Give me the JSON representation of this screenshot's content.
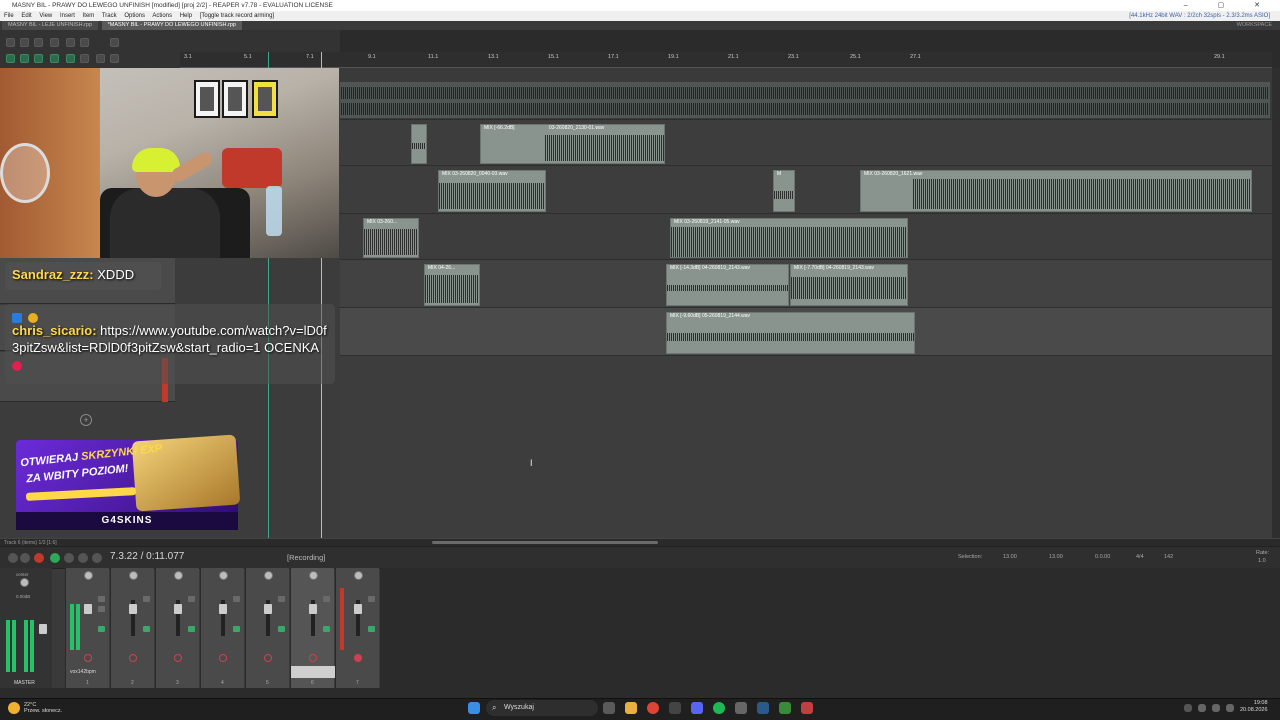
{
  "window": {
    "title": "MASNY BIL - PRAWY DO LEWEGO UNFINISH [modified] [proj 2/2] - REAPER v7.78 - EVALUATION LICENSE",
    "controls": "– ▢ ✕"
  },
  "menu": {
    "items": [
      "File",
      "Edit",
      "View",
      "Insert",
      "Item",
      "Track",
      "Options",
      "Actions",
      "Help"
    ],
    "action_hint": "[Toggle track record arming]",
    "audio_status": "[44.1kHz 24bit WAV : 2/2ch 32spls - 2.3/3.2ms ASIO]"
  },
  "tabs": [
    {
      "label": "MASNY BIL - LEJE UNFINISH.rpp"
    },
    {
      "label": "*MASNY BIL - PRAWY DO LEWEGO UNFINISH.rpp"
    }
  ],
  "tabs_right": "WORKSPACE",
  "ruler": {
    "ticks": [
      "3.1",
      "5.1",
      "7.1",
      "9.1",
      "11.1",
      "13.1",
      "15.1",
      "17.1",
      "19.1",
      "21.1",
      "23.1",
      "25.1",
      "27.1",
      "29.1"
    ]
  },
  "items": {
    "r2a": "MIX [-66.2dB]",
    "r2b": "03-260820_2130-01.wav",
    "r3a": "MIX 03-260820_0040-03.wav",
    "r3b": "M",
    "r3c": "MIX 03-260820_1621.wav",
    "r4a": "MIX 03-260...",
    "r4b": "MIX 03-260819_2141-05.wav",
    "r5a": "MIX 04-26...",
    "r5b": "MIX [-14.3dB] 04-260819_2143.wav",
    "r5c": "MIX [-7.70dB] 04-260819_2143.wav",
    "r6a": "MIX [-9.60dB] 05-260819_2144.wav"
  },
  "chat": {
    "msg1": {
      "user": "Sandraz_zzz:",
      "text": "XDDD"
    },
    "msg2": {
      "user": "chris_sicario:",
      "text": "https://www.youtube.com/watch?v=lD0f3pitZsw&list=RDlD0f3pitZsw&start_radio=1",
      "text2": "OCENKA"
    }
  },
  "ad": {
    "line1a": "OTWIERAJ",
    "line1b": "SKRZYNKI EXP",
    "line2": "ZA WBITY POZIOM!",
    "brand": "G4SKINS"
  },
  "transport": {
    "time": "7.3.22 / 0:11.077",
    "state": "[Recording]",
    "selection_label": "Selection:",
    "sel_start": "13.00",
    "sel_end": "13.00",
    "sel_len": "0.0.00",
    "timesig": "4/4",
    "bpm": "142",
    "rate_label": "Rate:",
    "rate": "1.0"
  },
  "mixer": {
    "master_label": "MASTER",
    "master_db": "0.00dB",
    "center_label": "center",
    "track_name": "vox142bpm",
    "track_numbers": [
      "1",
      "2",
      "3",
      "4",
      "5",
      "6",
      "7"
    ],
    "status_text": "Track 6 (items) 1/3 [1:6]"
  },
  "taskbar": {
    "weather_temp": "22°C",
    "weather_desc": "Przew. słonecz.",
    "search": "Wyszukaj",
    "time": "19:08",
    "date": "20.08.2026"
  },
  "colors": {
    "accent_green": "#26c26a",
    "record_red": "#c0392b",
    "playhead": "#d4c24a",
    "item_gray": "#8a948f"
  }
}
